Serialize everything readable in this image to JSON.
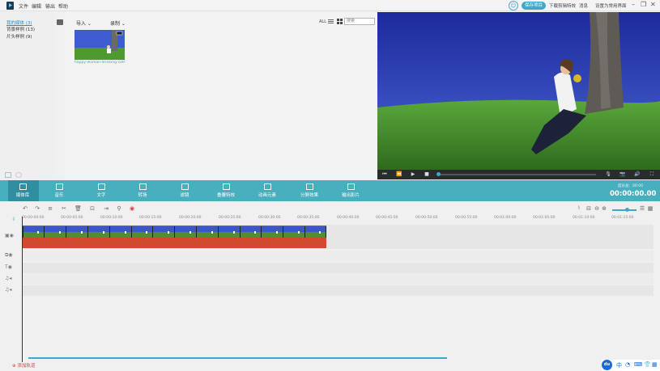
{
  "menu": [
    "文件",
    "编辑",
    "输出",
    "帮助"
  ],
  "header": {
    "save_button": "保存项目",
    "link_download": "下载剪辑特效",
    "link_messages": "消息",
    "link_default_interface": "设置为常用界面"
  },
  "library": {
    "items": [
      {
        "label": "我的媒体 (3)",
        "active": true
      },
      {
        "label": "背景样例 (13)",
        "active": false
      },
      {
        "label": "片头样例 (9)",
        "active": false
      }
    ]
  },
  "media": {
    "import_label": "导入 ⌄",
    "record_label": "录制 ⌄",
    "view_all": "ALL",
    "search_placeholder": "搜索",
    "thumb_caption": "happy-woman-drinking-cofee..."
  },
  "toolbar": {
    "tools": [
      {
        "label": "媒体库",
        "icon": "folder-icon"
      },
      {
        "label": "音乐",
        "icon": "music-note-icon"
      },
      {
        "label": "文字",
        "icon": "text-icon"
      },
      {
        "label": "转场",
        "icon": "transition-icon"
      },
      {
        "label": "滤镜",
        "icon": "filter-icon"
      },
      {
        "label": "叠覆特效",
        "icon": "overlay-icon"
      },
      {
        "label": "动画元素",
        "icon": "image-icon"
      },
      {
        "label": "分屏效果",
        "icon": "split-screen-icon"
      },
      {
        "label": "输出影片",
        "icon": "export-icon"
      }
    ],
    "duration_label": "度长总：00:00",
    "timecode": "00:00:00.00"
  },
  "ruler": {
    "ticks": [
      "00:00:00:00",
      "00:00:05:00",
      "00:00:10:00",
      "00:00:15:00",
      "00:00:20:00",
      "00:00:25:00",
      "00:00:30:00",
      "00:00:35:00",
      "00:00:40:00",
      "00:00:45:00",
      "00:00:50:00",
      "00:00:55:00",
      "00:01:00:00",
      "00:01:05:00",
      "00:01:10:00",
      "00:01:15:00"
    ]
  },
  "timeline": {
    "add_track": "添加轨道"
  },
  "tray": {
    "du_label": "du",
    "ime": "中"
  },
  "colors": {
    "accent": "#48afbf",
    "clip": "#d14a2e",
    "preview_sky": "#2a3aa8"
  }
}
